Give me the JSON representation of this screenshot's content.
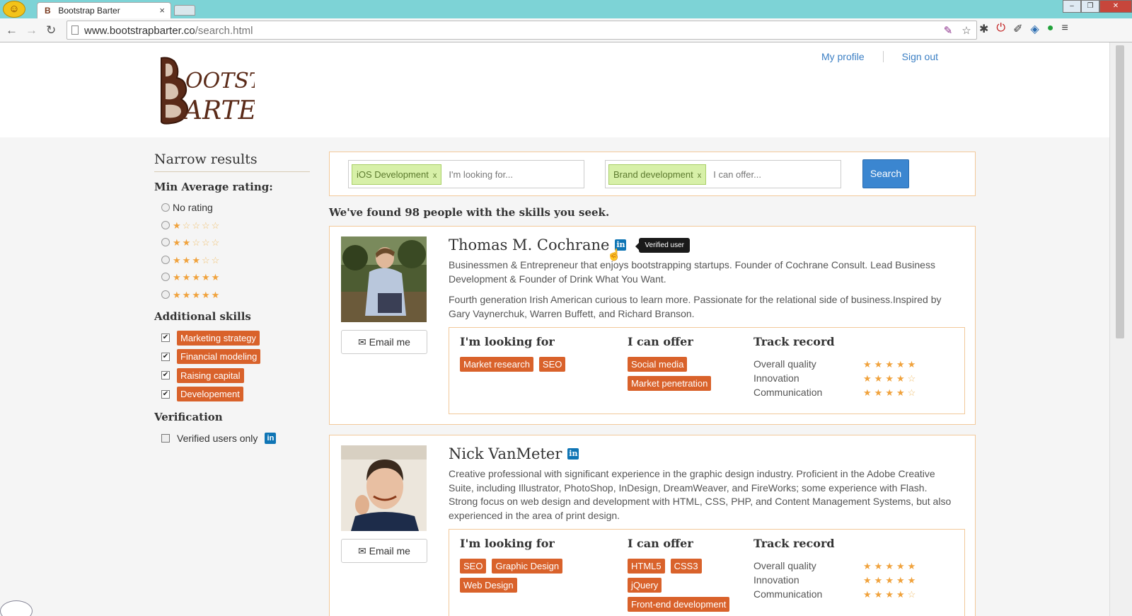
{
  "browser": {
    "tab_title": "Bootstrap Barter",
    "tab_close": "×",
    "url_host": "www.bootstrapbarter.co",
    "url_path": "/search.html"
  },
  "header": {
    "my_profile": "My profile",
    "sign_out": "Sign out"
  },
  "sidebar": {
    "title": "Narrow results",
    "rating_heading": "Min Average rating:",
    "no_rating": "No rating",
    "rating_options": [
      1,
      2,
      3,
      5,
      5
    ],
    "skills_heading": "Additional skills",
    "skills": [
      "Marketing strategy",
      "Financial modeling",
      "Raising capital",
      "Developement"
    ],
    "verification_heading": "Verification",
    "verified_only": "Verified users only"
  },
  "search": {
    "looking_tag": "iOS Development",
    "looking_placeholder": "I'm looking for...",
    "offer_tag": "Brand development",
    "offer_placeholder": "I can offer...",
    "button": "Search",
    "tag_remove": "x"
  },
  "results_text": "We've found 98 people with the skills you seek.",
  "labels": {
    "email": "Email me",
    "looking_for": "I'm looking for",
    "can_offer": "I can offer",
    "track_record": "Track record",
    "overall": "Overall quality",
    "innovation": "Innovation",
    "communication": "Communication",
    "verified_tooltip": "Verified user",
    "linkedin_glyph": "in"
  },
  "people": [
    {
      "name": "Thomas M. Cochrane",
      "bio1": "Businessmen & Entrepreneur that enjoys bootstrapping startups. Founder of Cochrane Consult. Lead Business Development & Founder of Drink What You Want.",
      "bio2": "Fourth generation Irish American curious to learn more. Passionate for the relational side of business.Inspired by Gary Vaynerchuk, Warren Buffett, and Richard Branson.",
      "looking_for": [
        "Market research",
        "SEO"
      ],
      "can_offer": [
        "Social media",
        "Market penetration"
      ],
      "ratings": {
        "overall": 5,
        "innovation": 4,
        "communication": 4
      }
    },
    {
      "name": "Nick VanMeter",
      "bio1": "Creative professional with significant experience in the graphic design industry. Proficient in the Adobe Creative Suite, including Illustrator, PhotoShop, InDesign, DreamWeaver, and FireWorks; some experience with Flash. Strong focus on web design and development with HTML, CSS, PHP, and Content Management Systems, but also experienced in the area of print design.",
      "looking_for": [
        "SEO",
        "Graphic Design",
        "Web Design"
      ],
      "can_offer": [
        "HTML5",
        "CSS3",
        "jQuery",
        "Front-end development"
      ],
      "ratings": {
        "overall": 5,
        "innovation": 5,
        "communication": 4
      }
    }
  ],
  "icons": {
    "back": "back-arrow-icon",
    "forward": "forward-arrow-icon",
    "reload": "reload-icon",
    "bookmark": "star-icon",
    "menu": "hamburger-menu-icon",
    "email": "envelope-icon",
    "linkedin": "linkedin-icon"
  },
  "colors": {
    "skill_tag": "#d9622b",
    "search_tag": "#d7f0a8",
    "search_button": "#3b86d0",
    "link": "#3b7fc4",
    "card_border": "#f2c99a",
    "star": "#f0a23c"
  }
}
